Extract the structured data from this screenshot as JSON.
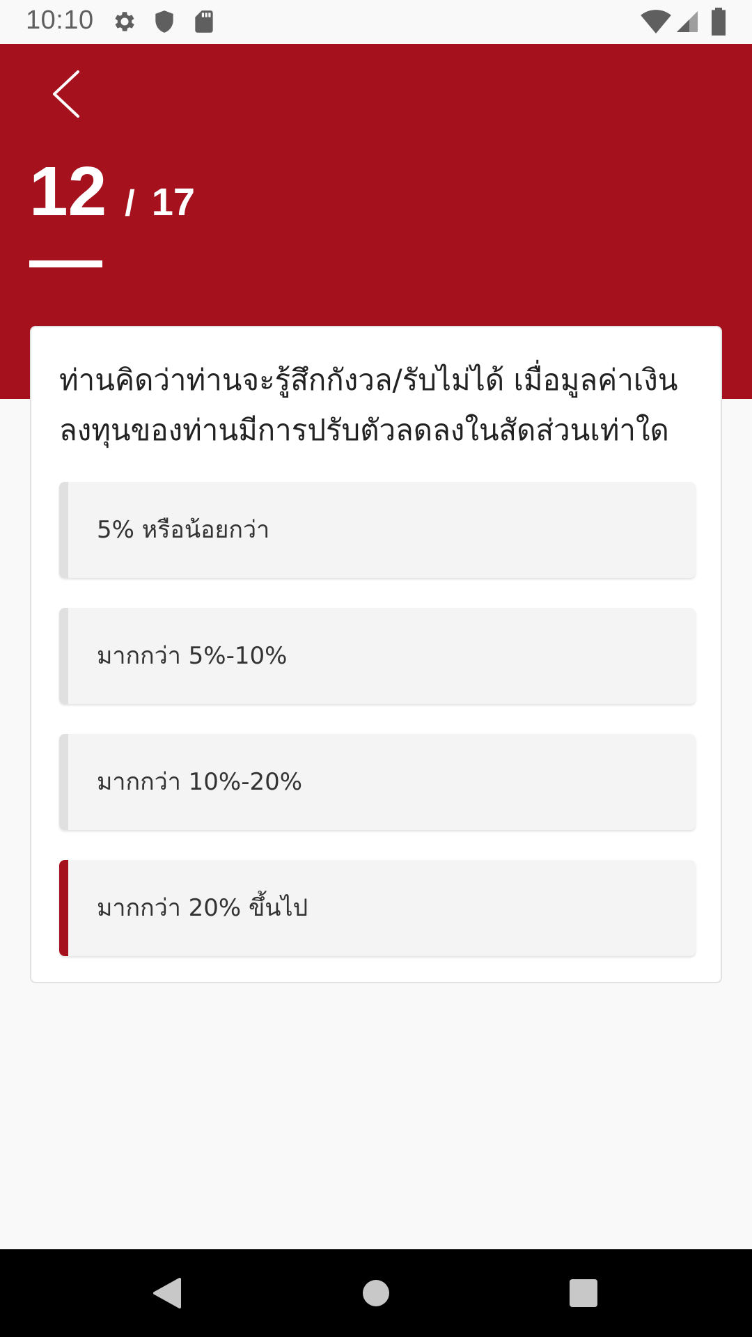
{
  "status_bar": {
    "time": "10:10",
    "icons": [
      "gear-icon",
      "shield-icon",
      "sd-card-icon",
      "wifi-icon",
      "signal-icon",
      "battery-icon"
    ]
  },
  "header": {
    "back_icon": "chevron-left-icon",
    "progress_current": "12",
    "progress_separator": "/",
    "progress_total": "17",
    "background_color": "#a6111e"
  },
  "question": {
    "text": "ท่านคิดว่าท่านจะรู้สึกกังวล/รับไม่ได้ เมื่อมูลค่าเงินลงทุนของท่านมีการปรับตัวลดลงในสัดส่วนเท่าใด"
  },
  "options": [
    {
      "label": "5% หรือน้อยกว่า",
      "selected": false
    },
    {
      "label": "มากกว่า 5%-10%",
      "selected": false
    },
    {
      "label": "มากกว่า 10%-20%",
      "selected": false
    },
    {
      "label": "มากกว่า 20% ขึ้นไป",
      "selected": true
    }
  ],
  "colors": {
    "accent": "#a6111e",
    "option_background": "#f4f4f4",
    "option_bar_default": "#e0e0e0"
  },
  "nav_bar": {
    "buttons": [
      "back-triangle-icon",
      "home-circle-icon",
      "recents-square-icon"
    ]
  }
}
